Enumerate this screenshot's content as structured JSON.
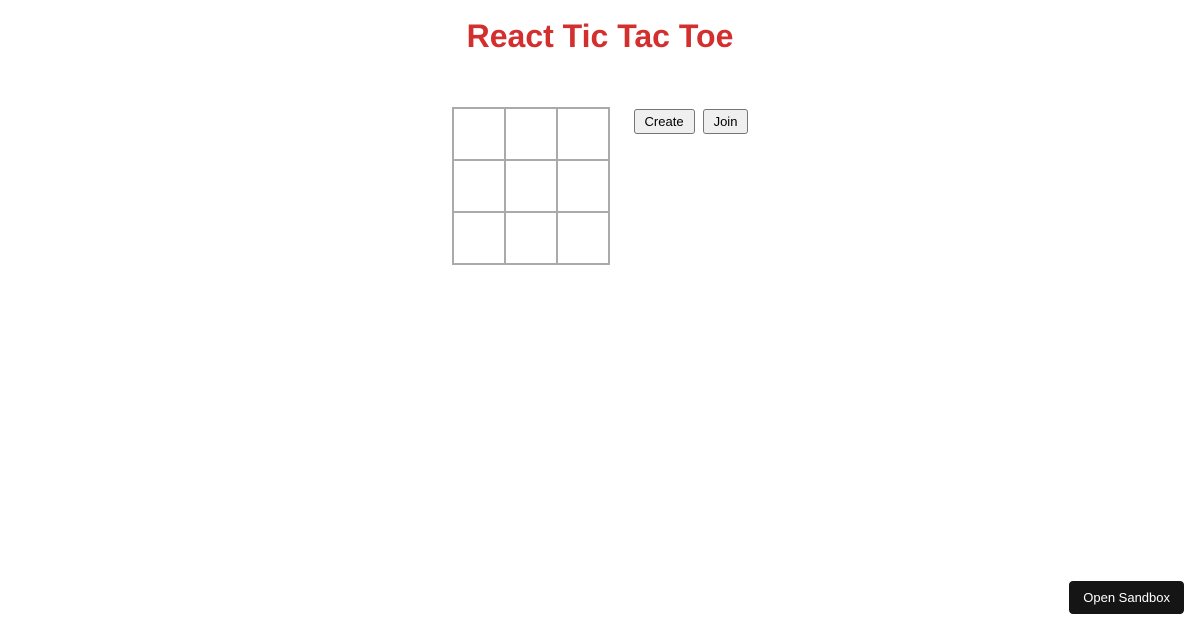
{
  "title": "React Tic Tac Toe",
  "board": {
    "cells": [
      "",
      "",
      "",
      "",
      "",
      "",
      "",
      "",
      ""
    ]
  },
  "controls": {
    "create_label": "Create",
    "join_label": "Join"
  },
  "sandbox": {
    "open_label": "Open Sandbox"
  }
}
